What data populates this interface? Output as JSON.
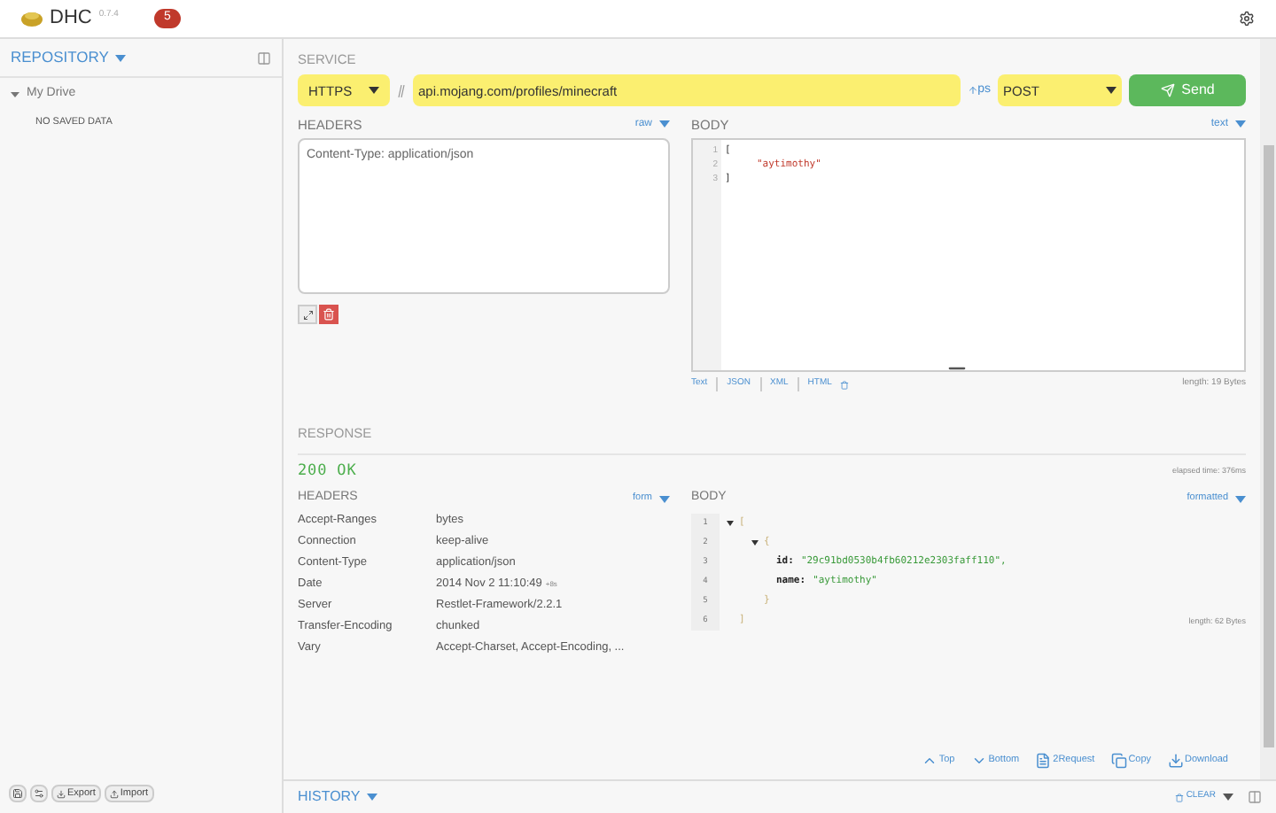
{
  "app": {
    "title": "DHC",
    "version": "0.7.4",
    "badge": "5"
  },
  "sidebar": {
    "title": "REPOSITORY",
    "tree": [
      {
        "label": "My Drive",
        "expanded": true,
        "children": [
          {
            "label": "NO SAVED DATA"
          }
        ]
      }
    ],
    "footer_buttons": [
      {
        "kind": "icon"
      },
      {
        "kind": "icon"
      },
      {
        "kind": "text",
        "label": "Export"
      },
      {
        "kind": "text",
        "label": "Import"
      }
    ]
  },
  "service": {
    "title": "SERVICE",
    "scheme": "HTTPS",
    "url": "api.mojang.com/profiles/minecraft",
    "params": "ps",
    "method": "POST",
    "send": "Send"
  },
  "request": {
    "headers": {
      "title": "HEADERS",
      "mode": "raw",
      "value": "Content-Type: application/json"
    },
    "body": {
      "title": "BODY",
      "mode": "text",
      "lines": [
        {
          "number": "1",
          "text": "[",
          "kind": "punct"
        },
        {
          "number": "2",
          "text": "\"aytimothy\"",
          "kind": "string"
        },
        {
          "number": "3",
          "text": "]",
          "kind": "punct"
        }
      ],
      "formats": [
        "Text",
        "JSON",
        "XML",
        "HTML"
      ],
      "length": "length: 19 Bytes"
    }
  },
  "response": {
    "title": "RESPONSE",
    "status": "200 OK",
    "elapsed": "elapsed time: 376ms",
    "headers": {
      "title": "HEADERS",
      "mode": "form",
      "rows": [
        {
          "name": "Accept-Ranges",
          "value": "bytes"
        },
        {
          "name": "Connection",
          "value": "keep-alive"
        },
        {
          "name": "Content-Type",
          "value": "application/json"
        },
        {
          "name": "Date",
          "value": "2014 Nov 2 11:10:49",
          "suffix": "+8s"
        },
        {
          "name": "Server",
          "value": "Restlet-Framework/2.2.1"
        },
        {
          "name": "Transfer-Encoding",
          "value": "chunked"
        },
        {
          "name": "Vary",
          "value": "Accept-Charset, Accept-Encoding, ..."
        }
      ]
    },
    "body": {
      "title": "BODY",
      "mode": "formatted",
      "tree": [
        {
          "number": "1",
          "open": "[",
          "expanded": true,
          "children": [
            {
              "number": "2",
              "open": "{",
              "expanded": true,
              "children": [
                {
                  "number": "3",
                  "key": "id:",
                  "value": "\"29c91bd0530b4fb60212e2303faff110\","
                },
                {
                  "number": "4",
                  "key": "name:",
                  "value": "\"aytimothy\""
                }
              ],
              "close_number": "5",
              "close": "}"
            }
          ],
          "close_number": "6",
          "close": "]"
        }
      ],
      "length": "length: 62 Bytes"
    },
    "actions": [
      {
        "kind": "top",
        "label": "Top"
      },
      {
        "kind": "bottom",
        "label": "Bottom"
      },
      {
        "kind": "request",
        "label": "2Request"
      },
      {
        "kind": "copy",
        "label": "Copy"
      },
      {
        "kind": "download",
        "label": "Download"
      }
    ]
  },
  "history": {
    "title": "HISTORY",
    "clear": "CLEAR"
  }
}
